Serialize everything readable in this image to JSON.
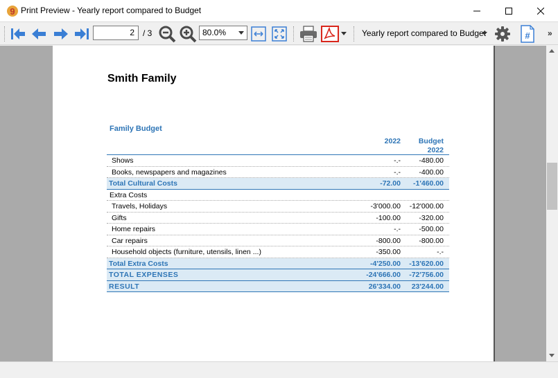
{
  "window": {
    "title": "Print Preview - Yearly report compared to Budget",
    "app_icon": "banana-app-icon"
  },
  "toolbar": {
    "page_current": "2",
    "page_total": "/ 3",
    "zoom": "80.0%",
    "report_name": "Yearly report compared to Budget",
    "overflow": "»",
    "icons": [
      "first-page-icon",
      "previous-page-icon",
      "next-page-icon",
      "last-page-icon",
      "zoom-out-icon",
      "zoom-in-icon",
      "fit-width-icon",
      "fit-page-icon",
      "print-icon",
      "pdf-icon",
      "settings-icon",
      "page-number-icon"
    ]
  },
  "report": {
    "family": "Smith Family",
    "title": "Family Budget",
    "col1_header": "2022",
    "col2_header_line1": "Budget",
    "col2_header_line2": "2022",
    "rows": [
      {
        "label": "Shows",
        "v1": "-.-",
        "v2": "-480.00",
        "kind": "item"
      },
      {
        "label": "Books, newspapers and magazines",
        "v1": "-.-",
        "v2": "-400.00",
        "kind": "item"
      },
      {
        "label": "Total Cultural Costs",
        "v1": "-72.00",
        "v2": "-1'460.00",
        "kind": "total"
      },
      {
        "label": "Extra Costs",
        "v1": "",
        "v2": "",
        "kind": "group"
      },
      {
        "label": "Travels, Holidays",
        "v1": "-3'000.00",
        "v2": "-12'000.00",
        "kind": "item"
      },
      {
        "label": "Gifts",
        "v1": "-100.00",
        "v2": "-320.00",
        "kind": "item"
      },
      {
        "label": "Home repairs",
        "v1": "-.-",
        "v2": "-500.00",
        "kind": "item"
      },
      {
        "label": "Car repairs",
        "v1": "-800.00",
        "v2": "-800.00",
        "kind": "item"
      },
      {
        "label": "Household objects (furniture, utensils, linen ...)",
        "v1": "-350.00",
        "v2": "-.-",
        "kind": "item"
      },
      {
        "label": "Total Extra Costs",
        "v1": "-4'250.00",
        "v2": "-13'620.00",
        "kind": "total"
      },
      {
        "label": "TOTAL EXPENSES",
        "v1": "-24'666.00",
        "v2": "-72'756.00",
        "kind": "total big"
      },
      {
        "label": "RESULT",
        "v1": "26'334.00",
        "v2": "23'244.00",
        "kind": "total big"
      }
    ]
  },
  "colors": {
    "accent_blue": "#2e75b6",
    "total_bg": "#dbeaf5",
    "pdf_red": "#d9261c",
    "nav_blue": "#3a7fd5"
  }
}
